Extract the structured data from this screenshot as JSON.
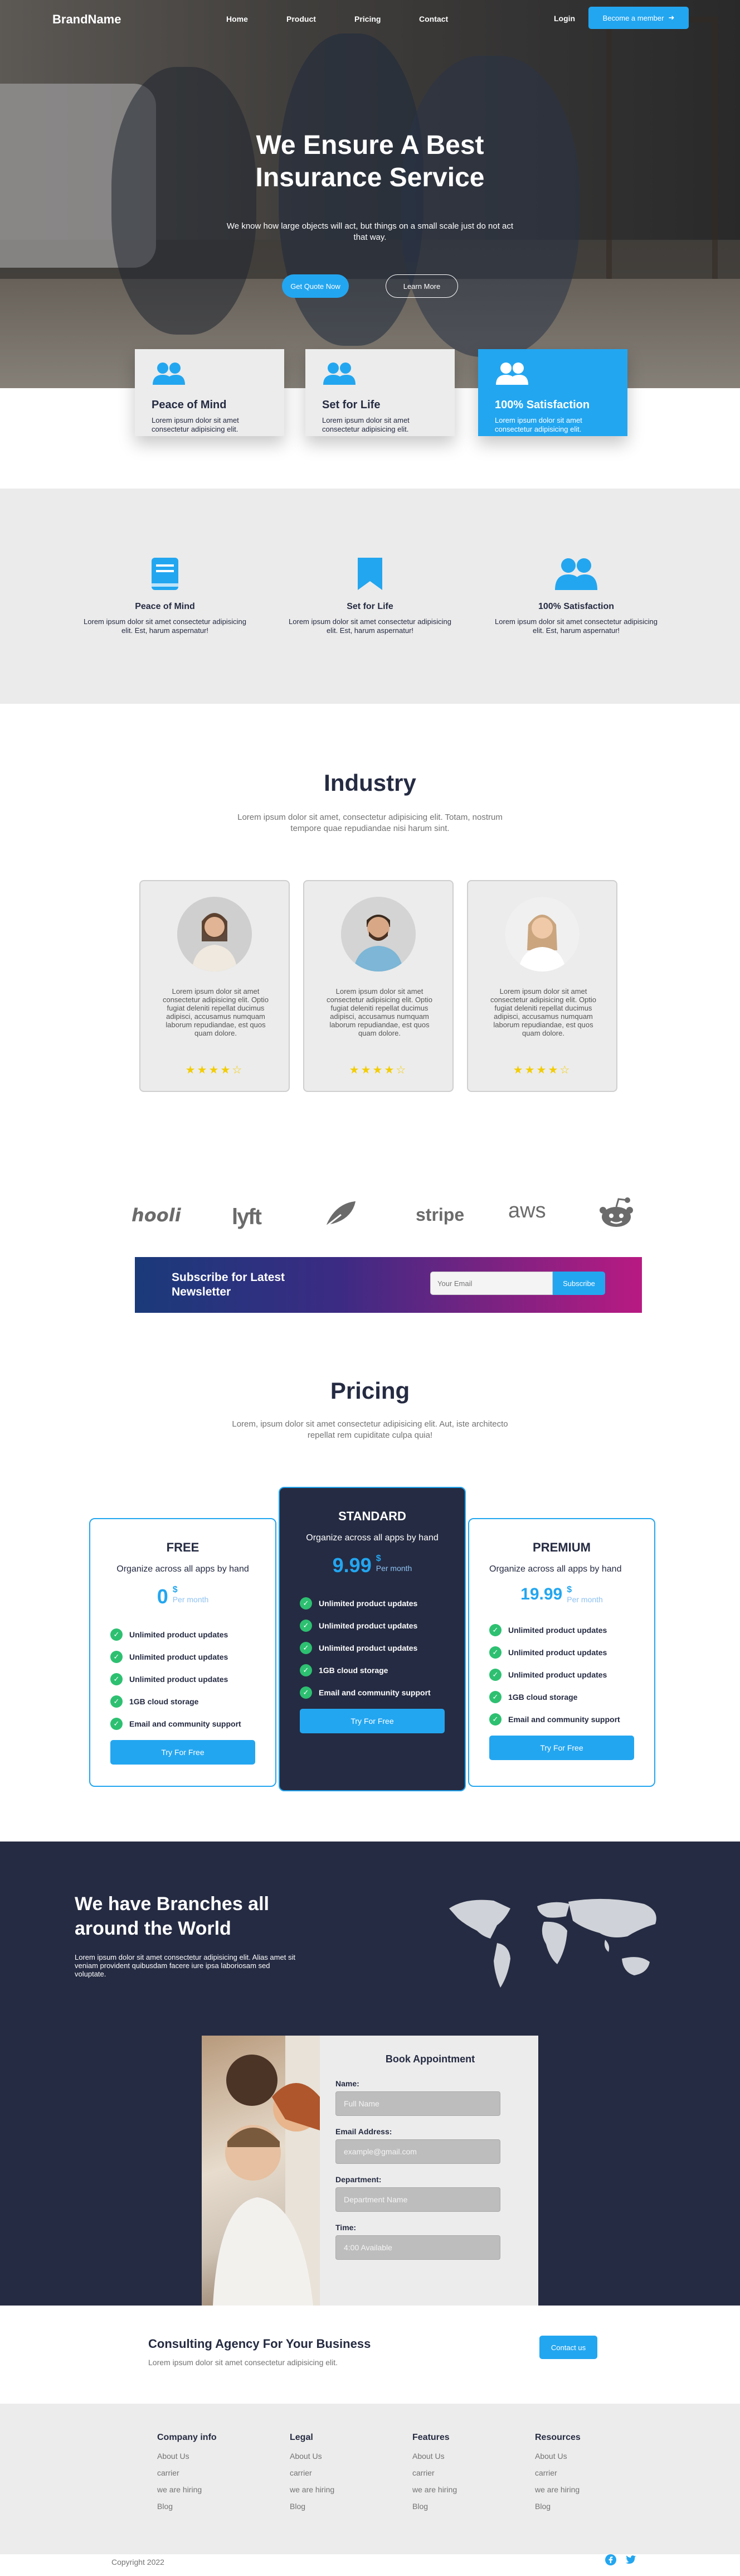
{
  "nav": {
    "brand": "BrandName",
    "links": [
      "Home",
      "Product",
      "Pricing",
      "Contact"
    ],
    "login": "Login",
    "member_button": "Become a member",
    "member_icon": "arrow-right-icon"
  },
  "hero": {
    "title": "We Ensure A Best Insurance Service",
    "subtitle": "We know how large objects will act, but things on a small scale just do not act that way.",
    "primary_button": "Get Quote Now",
    "secondary_button": "Learn More"
  },
  "feature_cards": [
    {
      "title": "Peace of Mind",
      "text": "Lorem ipsum dolor sit amet consectetur adipisicing elit.",
      "icon": "users-icon",
      "highlighted": false
    },
    {
      "title": "Set for Life",
      "text": "Lorem ipsum dolor sit amet consectetur adipisicing elit.",
      "icon": "users-icon",
      "highlighted": false
    },
    {
      "title": "100% Satisfaction",
      "text": "Lorem ipsum dolor sit amet consectetur adipisicing elit.",
      "icon": "users-icon",
      "highlighted": true
    }
  ],
  "features": [
    {
      "title": "Peace of Mind",
      "text": "Lorem ipsum dolor sit amet consectetur adipisicing elit. Est, harum aspernatur!",
      "icon": "book-icon"
    },
    {
      "title": "Set for Life",
      "text": "Lorem ipsum dolor sit amet consectetur adipisicing elit. Est, harum aspernatur!",
      "icon": "bookmark-icon"
    },
    {
      "title": "100% Satisfaction",
      "text": "Lorem ipsum dolor sit amet consectetur adipisicing elit. Est, harum aspernatur!",
      "icon": "users-icon"
    }
  ],
  "industry": {
    "title": "Industry",
    "subtitle": "Lorem ipsum dolor sit amet, consectetur adipisicing elit. Totam, nostrum tempore quae repudiandae nisi harum sint.",
    "testimonials": [
      {
        "text": "Lorem ipsum dolor sit amet consectetur adipisicing elit. Optio fugiat deleniti repellat ducimus adipisci, accusamus numquam laborum repudiandae, est quos quam dolore.",
        "rating": 4,
        "stars": "★★★★☆"
      },
      {
        "text": "Lorem ipsum dolor sit amet consectetur adipisicing elit. Optio fugiat deleniti repellat ducimus adipisci, accusamus numquam laborum repudiandae, est quos quam dolore.",
        "rating": 4,
        "stars": "★★★★☆"
      },
      {
        "text": "Lorem ipsum dolor sit amet consectetur adipisicing elit. Optio fugiat deleniti repellat ducimus adipisci, accusamus numquam laborum repudiandae, est quos quam dolore.",
        "rating": 4,
        "stars": "★★★★☆"
      }
    ]
  },
  "logos": [
    "hooli",
    "lyft",
    "leaf-logo",
    "stripe",
    "aws",
    "reddit-logo"
  ],
  "logo_text": {
    "hooli": "hooli",
    "lyft": "lyft",
    "stripe": "stripe",
    "aws": "aws"
  },
  "newsletter": {
    "title": "Subscribe for Latest Newsletter",
    "placeholder": "Your Email",
    "button": "Subscribe"
  },
  "pricing": {
    "title": "Pricing",
    "subtitle": "Lorem, ipsum dolor sit amet consectetur adipisicing elit. Aut, iste architecto repellat rem cupiditate culpa quia!",
    "plans": [
      {
        "name": "FREE",
        "desc": "Organize across all apps by hand",
        "price": "0",
        "currency": "$",
        "period": "Per month",
        "features": [
          "Unlimited product updates",
          "Unlimited product updates",
          "Unlimited product updates",
          "1GB cloud storage",
          "Email and community support"
        ],
        "button": "Try For Free"
      },
      {
        "name": "STANDARD",
        "desc": "Organize across all apps by hand",
        "price": "9.99",
        "currency": "$",
        "period": "Per month",
        "features": [
          "Unlimited product updates",
          "Unlimited product updates",
          "Unlimited product updates",
          "1GB cloud storage",
          "Email and community support"
        ],
        "button": "Try For Free"
      },
      {
        "name": "PREMIUM",
        "desc": "Organize across all apps by hand",
        "price": "19.99",
        "currency": "$",
        "period": "Per month",
        "features": [
          "Unlimited product updates",
          "Unlimited product updates",
          "Unlimited product updates",
          "1GB cloud storage",
          "Email and community support"
        ],
        "button": "Try For Free"
      }
    ]
  },
  "branches": {
    "title": "We have Branches all around the World",
    "text": "Lorem ipsum dolor sit amet consectetur adipisicing elit. Alias amet sit veniam provident quibusdam facere iure ipsa laboriosam sed voluptate."
  },
  "booking": {
    "title": "Book Appointment",
    "fields": [
      {
        "label": "Name:",
        "placeholder": "Full Name"
      },
      {
        "label": "Email Address:",
        "placeholder": "example@gmail.com"
      },
      {
        "label": "Department:",
        "placeholder": "Department Name"
      },
      {
        "label": "Time:",
        "placeholder": "4:00 Available"
      }
    ]
  },
  "consulting": {
    "title": "Consulting Agency For Your Business",
    "text": "Lorem ipsum dolor sit amet consectetur adipisicing elit.",
    "button": "Contact us"
  },
  "footer": {
    "columns": [
      {
        "title": "Company info",
        "links": [
          "About Us",
          "carrier",
          "we are hiring",
          "Blog"
        ]
      },
      {
        "title": "Legal",
        "links": [
          "About Us",
          "carrier",
          "we are hiring",
          "Blog"
        ]
      },
      {
        "title": "Features",
        "links": [
          "About Us",
          "carrier",
          "we are hiring",
          "Blog"
        ]
      },
      {
        "title": "Resources",
        "links": [
          "About Us",
          "carrier",
          "we are hiring",
          "Blog"
        ]
      }
    ],
    "copyright": "Copyright 2022",
    "social": [
      "facebook-icon",
      "twitter-icon"
    ]
  },
  "colors": {
    "primary": "#23A6F0",
    "dark": "#252B42",
    "success": "#2DC071",
    "star": "#F3CD03",
    "light_bg": "#EBEBEB"
  }
}
